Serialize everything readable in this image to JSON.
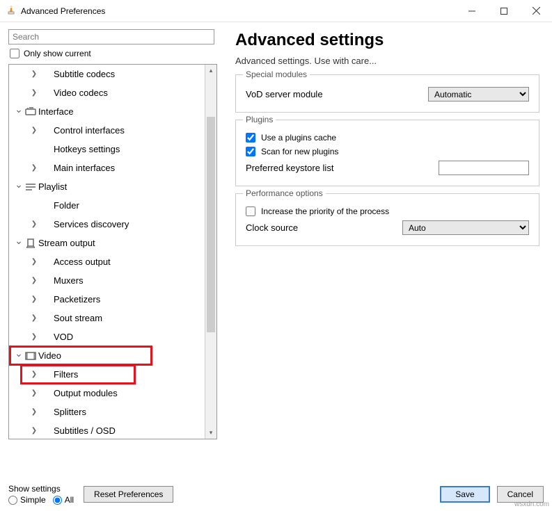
{
  "window": {
    "title": "Advanced Preferences"
  },
  "sidebar": {
    "search_placeholder": "Search",
    "only_show_current": "Only show current",
    "items": [
      {
        "label": "Subtitle codecs",
        "depth": 1,
        "caret": ">"
      },
      {
        "label": "Video codecs",
        "depth": 1,
        "caret": ">"
      },
      {
        "label": "Interface",
        "depth": 0,
        "caret": "v",
        "icon": "interface"
      },
      {
        "label": "Control interfaces",
        "depth": 1,
        "caret": ">"
      },
      {
        "label": "Hotkeys settings",
        "depth": 1,
        "caret": ""
      },
      {
        "label": "Main interfaces",
        "depth": 1,
        "caret": ">"
      },
      {
        "label": "Playlist",
        "depth": 0,
        "caret": "v",
        "icon": "playlist"
      },
      {
        "label": "Folder",
        "depth": 1,
        "caret": ""
      },
      {
        "label": "Services discovery",
        "depth": 1,
        "caret": ">"
      },
      {
        "label": "Stream output",
        "depth": 0,
        "caret": "v",
        "icon": "stream"
      },
      {
        "label": "Access output",
        "depth": 1,
        "caret": ">"
      },
      {
        "label": "Muxers",
        "depth": 1,
        "caret": ">"
      },
      {
        "label": "Packetizers",
        "depth": 1,
        "caret": ">"
      },
      {
        "label": "Sout stream",
        "depth": 1,
        "caret": ">"
      },
      {
        "label": "VOD",
        "depth": 1,
        "caret": ">"
      },
      {
        "label": "Video",
        "depth": 0,
        "caret": "v",
        "icon": "video"
      },
      {
        "label": "Filters",
        "depth": 1,
        "caret": ">"
      },
      {
        "label": "Output modules",
        "depth": 1,
        "caret": ">"
      },
      {
        "label": "Splitters",
        "depth": 1,
        "caret": ">"
      },
      {
        "label": "Subtitles / OSD",
        "depth": 1,
        "caret": ">"
      }
    ]
  },
  "main": {
    "title": "Advanced settings",
    "subtitle": "Advanced settings. Use with care...",
    "groups": {
      "special": {
        "legend": "Special modules",
        "vod_label": "VoD server module",
        "vod_value": "Automatic"
      },
      "plugins": {
        "legend": "Plugins",
        "use_cache": "Use a plugins cache",
        "scan_new": "Scan for new plugins",
        "keystore_label": "Preferred keystore list",
        "keystore_value": ""
      },
      "perf": {
        "legend": "Performance options",
        "priority": "Increase the priority of the process",
        "clock_label": "Clock source",
        "clock_value": "Auto"
      }
    }
  },
  "bottom": {
    "show_label": "Show settings",
    "simple": "Simple",
    "all": "All",
    "reset": "Reset Preferences",
    "save": "Save",
    "cancel": "Cancel"
  },
  "watermark": "wsxdn.com"
}
